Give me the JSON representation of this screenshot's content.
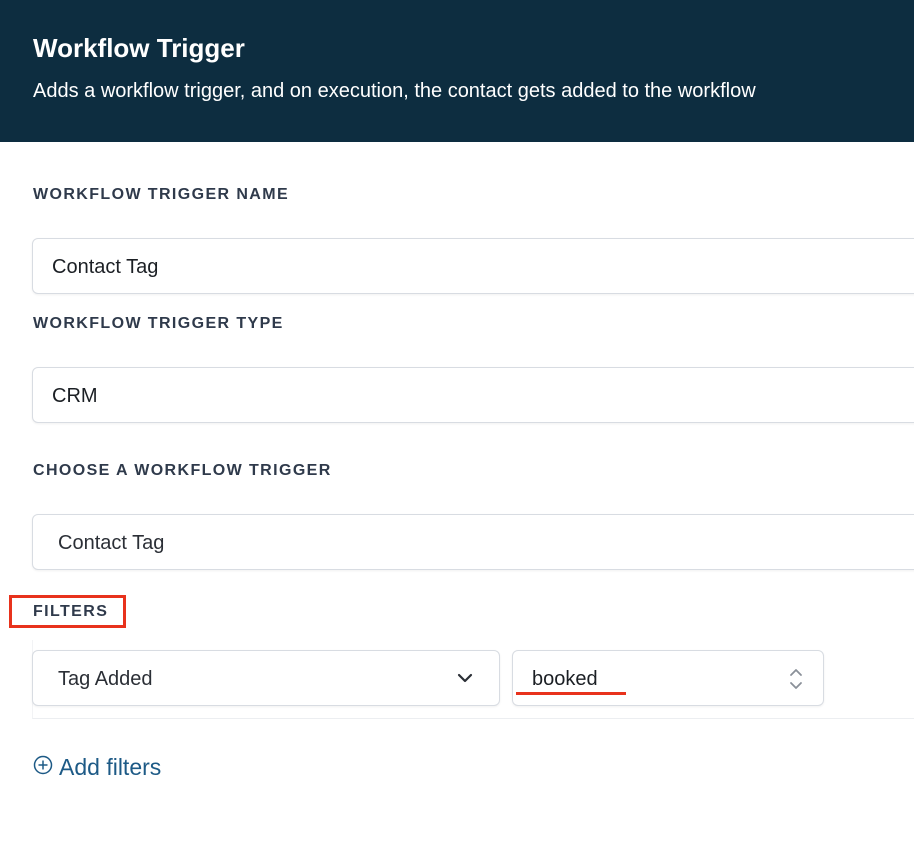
{
  "header": {
    "title": "Workflow Trigger",
    "subtitle": "Adds a workflow trigger, and on execution, the contact gets added to the workflow"
  },
  "form": {
    "name_label": "WORKFLOW TRIGGER NAME",
    "name_value": "Contact Tag",
    "type_label": "WORKFLOW TRIGGER TYPE",
    "type_value": "CRM",
    "choose_label": "CHOOSE A WORKFLOW TRIGGER",
    "choose_value": "Contact Tag",
    "filters_label": "FILTERS",
    "filter_condition": "Tag Added",
    "filter_value": "booked",
    "add_filters_label": "Add filters"
  },
  "colors": {
    "header_bg": "#0d2d40",
    "annotation_red": "#e8321c",
    "link_blue": "#1d5a86"
  },
  "icons": [
    "chevron-down-icon",
    "sort-arrows-icon",
    "plus-circle-icon"
  ]
}
